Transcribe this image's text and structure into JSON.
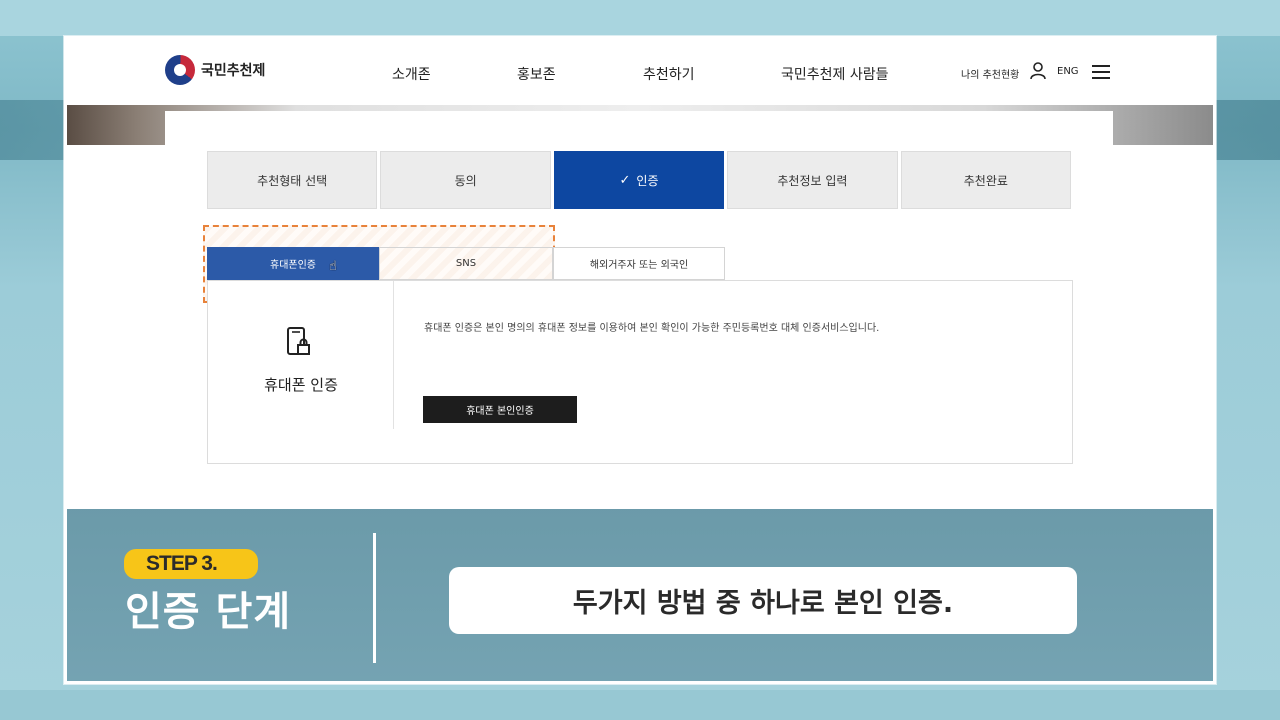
{
  "header": {
    "brand": "국민추천제",
    "nav": [
      "소개존",
      "홍보존",
      "추천하기",
      "국민추천제 사람들"
    ],
    "my_status": "나의 추천현황",
    "lang": "ENG"
  },
  "steps": [
    {
      "label": "추천형태 선택",
      "active": false
    },
    {
      "label": "동의",
      "active": false
    },
    {
      "label": "인증",
      "active": true
    },
    {
      "label": "추천정보 입력",
      "active": false
    },
    {
      "label": "추천완료",
      "active": false
    }
  ],
  "subtabs": [
    "휴대폰인증",
    "SNS",
    "해외거주자 또는 외국인"
  ],
  "auth_panel": {
    "title": "휴대폰 인증",
    "description": "휴대폰 인증은 본인 명의의 휴대폰 정보를 이용하여 본인 확인이 가능한 주민등록번호 대체 인증서비스입니다.",
    "button": "휴대폰 본인인증"
  },
  "caption": {
    "step": "STEP 3.",
    "title": "인증 단계",
    "text": "두가지 방법 중 하나로 본인 인증."
  },
  "colors": {
    "active_step": "#0d47a1",
    "active_subtab": "#2c5aa8",
    "highlight": "#e8823a",
    "badge": "#f7c518"
  }
}
